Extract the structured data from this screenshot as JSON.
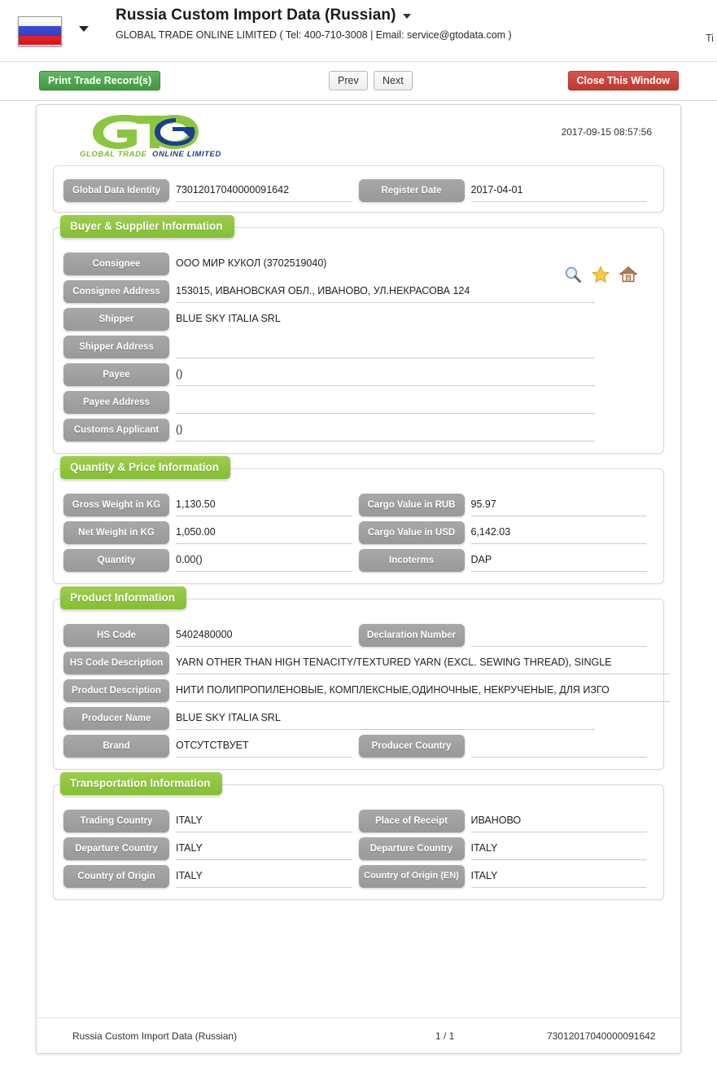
{
  "header": {
    "flag_alt": "russia-flag",
    "title": "Russia Custom Import Data (Russian)",
    "subtitle": "GLOBAL TRADE ONLINE LIMITED ( Tel: 400-710-3008 | Email: service@gtodata.com )",
    "corner_clipped": "Ti"
  },
  "toolbar": {
    "print_label": "Print Trade Record(s)",
    "prev_label": "Prev",
    "next_label": "Next",
    "close_label": "Close This Window"
  },
  "logo": {
    "mark": "GTO",
    "tagline_green": "GLOBAL TRADE",
    "tagline_blue": "ONLINE LIMITED",
    "stamp_date": "2017-09-15 08:57:56"
  },
  "identity": {
    "global_data_identity_label": "Global Data Identity",
    "global_data_identity_value": "73012017040000091642",
    "register_date_label": "Register Date",
    "register_date_value": "2017-04-01"
  },
  "buyer_supplier": {
    "title": "Buyer & Supplier Information",
    "icons": [
      "search-icon",
      "star-icon",
      "home-icon"
    ],
    "fields": [
      {
        "label": "Consignee",
        "value": "ООО МИР КУКОЛ (3702519040)"
      },
      {
        "label": "Consignee Address",
        "value": "153015, ИВАНОВСКАЯ ОБЛ., ИВАНОВО, УЛ.НЕКРАСОВА 124"
      },
      {
        "label": "Shipper",
        "value": "BLUE SKY ITALIA SRL"
      },
      {
        "label": "Shipper Address",
        "value": ""
      },
      {
        "label": "Payee",
        "value": "()"
      },
      {
        "label": "Payee Address",
        "value": ""
      },
      {
        "label": "Customs Applicant",
        "value": "()"
      }
    ]
  },
  "quantity_price": {
    "title": "Quantity & Price Information",
    "left": [
      {
        "label": "Gross Weight in KG",
        "value": "1,130.50"
      },
      {
        "label": "Net Weight in KG",
        "value": "1,050.00"
      },
      {
        "label": "Quantity",
        "value": "0.00()"
      }
    ],
    "right": [
      {
        "label": "Cargo Value in RUB",
        "value": "95.97"
      },
      {
        "label": "Cargo Value in USD",
        "value": "6,142.03"
      },
      {
        "label": "Incoterms",
        "value": "DAP"
      }
    ]
  },
  "product": {
    "title": "Product Information",
    "hs_code_label": "HS Code",
    "hs_code_value": "5402480000",
    "declaration_label": "Declaration Number",
    "declaration_value": "",
    "hs_desc_label": "HS Code Description",
    "hs_desc_value": "YARN OTHER THAN HIGH TENACITY/TEXTURED YARN (EXCL. SEWING THREAD), SINGLE",
    "prod_desc_label": "Product Description",
    "prod_desc_value": "НИТИ ПОЛИПРОПИЛЕНОВЫЕ, КОМПЛЕКСНЫЕ,ОДИНОЧНЫЕ, НЕКРУЧЕНЫЕ, ДЛЯ ИЗГО",
    "producer_name_label": "Producer Name",
    "producer_name_value": "BLUE SKY ITALIA SRL",
    "brand_label": "Brand",
    "brand_value": "ОТСУТСТВУЕТ",
    "producer_country_label": "Producer Country",
    "producer_country_value": ""
  },
  "transport": {
    "title": "Transportation Information",
    "left": [
      {
        "label": "Trading Country",
        "value": "ITALY"
      },
      {
        "label": "Departure Country",
        "value": "ITALY"
      },
      {
        "label": "Country of Origin",
        "value": "ITALY"
      }
    ],
    "right": [
      {
        "label": "Place of Receipt",
        "value": "ИВАНОВО"
      },
      {
        "label": "Departure Country",
        "value": "ITALY"
      },
      {
        "label": "Country of Origin (EN)",
        "value": "ITALY"
      }
    ]
  },
  "footer": {
    "source": "Russia Custom Import Data (Russian)",
    "page": "1 / 1",
    "record_id": "73012017040000091642"
  },
  "colors": {
    "accent_green": "#8cc63e",
    "label_gray": "#9d9d9d",
    "print_green": "#4a9e4a",
    "close_red": "#cc3a30"
  }
}
